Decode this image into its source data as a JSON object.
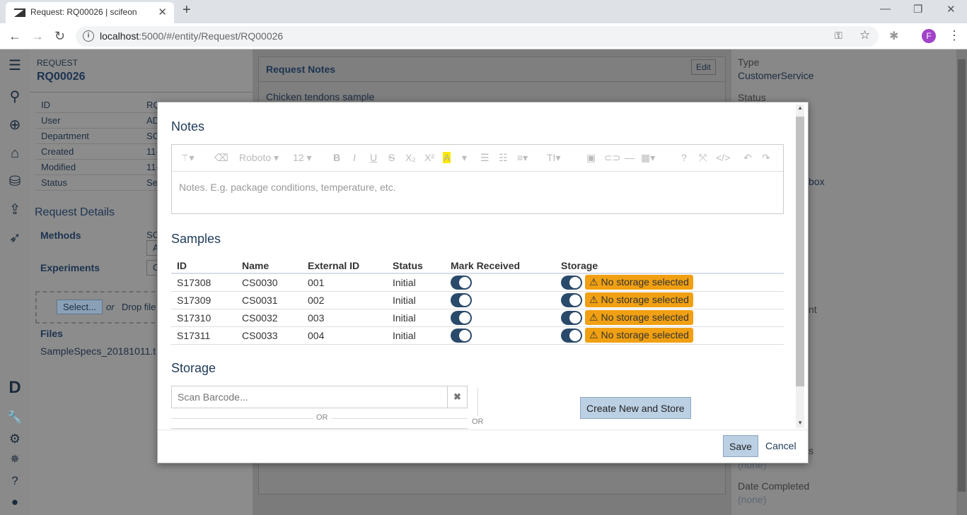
{
  "browser": {
    "tab_title": "Request: RQ00026 | scifeon",
    "url_host": "localhost",
    "url_rest": ":5000/#/entity/Request/RQ00026",
    "avatar_letter": "F"
  },
  "left": {
    "kind": "REQUEST",
    "id": "RQ00026",
    "fields": [
      {
        "label": "ID",
        "value": "RQ"
      },
      {
        "label": "User",
        "value": "AD"
      },
      {
        "label": "Department",
        "value": "SC"
      },
      {
        "label": "Created",
        "value": "11-"
      },
      {
        "label": "Modified",
        "value": "11-"
      },
      {
        "label": "Status",
        "value": "Se"
      }
    ],
    "details_title": "Request Details",
    "methods_label": "Methods",
    "methods_value": "SC",
    "methods_btn": "A",
    "experiments_label": "Experiments",
    "experiments_btn": "C",
    "select_btn": "Select...",
    "or_text": "or",
    "drop_text": "Drop file",
    "files_title": "Files",
    "file_name": "SampleSpecs_20181011.t"
  },
  "middle": {
    "notes_title": "Request Notes",
    "edit_btn": "Edit",
    "notes_text": "Chicken tendons sample"
  },
  "right": {
    "type_label": "Type",
    "type_value": "CustomerService",
    "status_label": "Status",
    "frag1": "box",
    "frag2": "nt",
    "frag3": "s",
    "none1": "(none)",
    "completed_label": "Date Completed",
    "completed_value": "(none)"
  },
  "modal": {
    "notes_title": "Notes",
    "toolbar": {
      "font": "Roboto",
      "size": "12"
    },
    "notes_placeholder": "Notes. E.g. package conditions, temperature, etc.",
    "samples_title": "Samples",
    "columns": [
      "ID",
      "Name",
      "External ID",
      "Status",
      "Mark Received",
      "Storage"
    ],
    "samples": [
      {
        "id": "S17308",
        "name": "CS0030",
        "ext": "001",
        "status": "Initial",
        "received": true,
        "storage_on": true,
        "storage": "No storage selected"
      },
      {
        "id": "S17309",
        "name": "CS0031",
        "ext": "002",
        "status": "Initial",
        "received": true,
        "storage_on": true,
        "storage": "No storage selected"
      },
      {
        "id": "S17310",
        "name": "CS0032",
        "ext": "003",
        "status": "Initial",
        "received": true,
        "storage_on": true,
        "storage": "No storage selected"
      },
      {
        "id": "S17311",
        "name": "CS0033",
        "ext": "004",
        "status": "Initial",
        "received": true,
        "storage_on": true,
        "storage": "No storage selected"
      }
    ],
    "storage_title": "Storage",
    "barcode_placeholder": "Scan Barcode...",
    "or1": "OR",
    "or2": "OR",
    "create_btn": "Create New and Store",
    "save_btn": "Save",
    "cancel_btn": "Cancel"
  },
  "colors": {
    "accent": "#1f3b5a",
    "warning": "#f0a012",
    "toggle": "#2a4a6b"
  }
}
